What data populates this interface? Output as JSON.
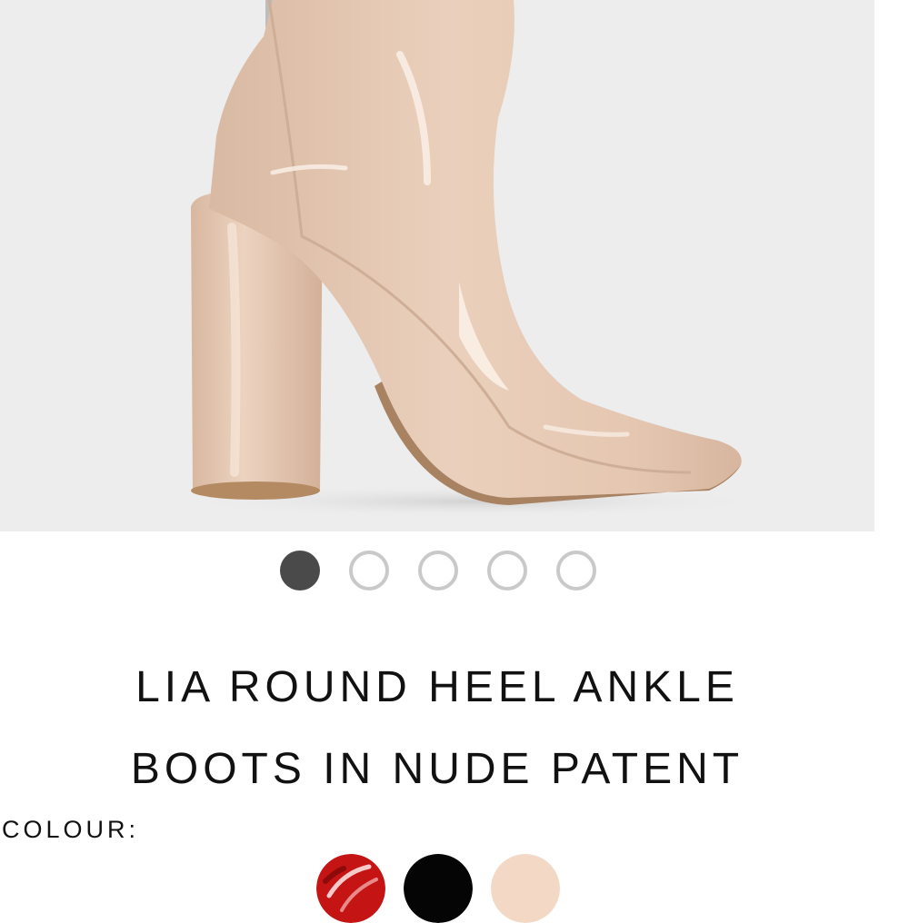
{
  "product": {
    "title_line1": "LIA ROUND HEEL ANKLE",
    "title_line2": "BOOTS IN NUDE PATENT",
    "image_icon": "boot-photo"
  },
  "carousel": {
    "total": 5,
    "active_index": 0
  },
  "colour": {
    "label": "COLOUR:",
    "swatches": [
      {
        "name": "red-patent",
        "color": "#c41414"
      },
      {
        "name": "black",
        "color": "#050505"
      },
      {
        "name": "nude",
        "color": "#f3d8c5"
      }
    ]
  },
  "colors": {
    "image_background": "#ededee",
    "boot": "#e7c9b3",
    "active_dot": "#4a4a4a",
    "inactive_dot_border": "#c9c9c9"
  }
}
